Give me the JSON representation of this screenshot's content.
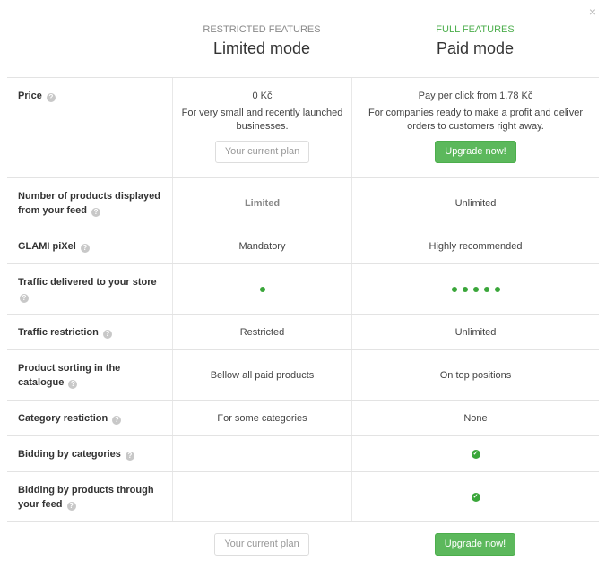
{
  "dialog": {
    "close_label": "×"
  },
  "plans": [
    {
      "subtitle": "RESTRICTED FEATURES",
      "title": "Limited mode",
      "accent": "#888888"
    },
    {
      "subtitle": "FULL FEATURES",
      "title": "Paid mode",
      "accent": "#4cae4c"
    }
  ],
  "colors": {
    "green": "#5cb85c",
    "dot_green": "#3aa63a",
    "help_grey": "#c8c8c8"
  },
  "rows": [
    {
      "label": "Price",
      "limited": {
        "price": "0 Kč",
        "desc": "For very small and recently launched businesses.",
        "button": "Your current plan"
      },
      "paid": {
        "price": "Pay per click from 1,78 Kč",
        "desc": "For companies ready to make a profit and deliver orders to customers right away.",
        "button": "Upgrade now!"
      }
    },
    {
      "label": "Number of products displayed from your feed",
      "limited": "Limited",
      "paid": "Unlimited"
    },
    {
      "label": "GLAMI piXel",
      "limited": "Mandatory",
      "paid": "Highly recommended"
    },
    {
      "label": "Traffic delivered to your store",
      "limited_dots": 1,
      "paid_dots": 5,
      "max_dots": 5
    },
    {
      "label": "Traffic restriction",
      "limited": "Restricted",
      "paid": "Unlimited"
    },
    {
      "label": "Product sorting in the catalogue",
      "limited": "Bellow all paid products",
      "paid": "On top positions"
    },
    {
      "label": "Category restiction",
      "limited": "For some categories",
      "paid": "None"
    },
    {
      "label": "Bidding by categories",
      "limited_check": false,
      "paid_check": true
    },
    {
      "label": "Bidding by products through your feed",
      "limited_check": false,
      "paid_check": true
    }
  ],
  "footer": {
    "limited_button": "Your current plan",
    "paid_button": "Upgrade now!"
  },
  "icons": {
    "help": "?",
    "check": "✓",
    "close": "×"
  }
}
